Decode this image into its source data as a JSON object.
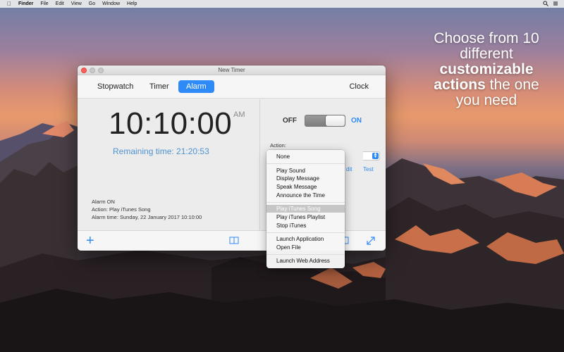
{
  "menubar": {
    "items": [
      {
        "label": "Finder",
        "bold": true
      },
      {
        "label": "File"
      },
      {
        "label": "Edit"
      },
      {
        "label": "View"
      },
      {
        "label": "Go"
      },
      {
        "label": "Window"
      },
      {
        "label": "Help"
      }
    ]
  },
  "promo": {
    "line1": "Choose from 10",
    "line2": "different",
    "line3": "customizable",
    "line4_bold": "actions",
    "line4_rest": " the one",
    "line5": "you need"
  },
  "window": {
    "title": "New Timer",
    "tabs": [
      {
        "label": "Stopwatch"
      },
      {
        "label": "Timer"
      },
      {
        "label": "Alarm",
        "active": true
      },
      {
        "label": "Clock"
      }
    ],
    "main": {
      "time": "10:10:00",
      "ampm": "AM",
      "remaining": "Remaining time: 21:20:53",
      "status": "Alarm ON",
      "action_line": "Action: Play iTunes Song",
      "alarm_time_line": "Alarm time: Sunday, 22 January 2017 10:10:00"
    },
    "side": {
      "off_label": "OFF",
      "on_label": "ON",
      "toggle_state": "on",
      "action_label": "Action:",
      "edit_partial": "dit",
      "test_label": "Test"
    }
  },
  "dropdown": {
    "items": [
      {
        "label": "None"
      },
      {
        "label": "Play Sound"
      },
      {
        "label": "Display Message"
      },
      {
        "label": "Speak Message"
      },
      {
        "label": "Announce the Time"
      },
      {
        "label": "Play iTunes Song",
        "highlighted": true
      },
      {
        "label": "Play iTunes Playlist"
      },
      {
        "label": "Stop iTunes"
      },
      {
        "label": "Launch Application"
      },
      {
        "label": "Open File"
      },
      {
        "label": "Launch Web Address"
      }
    ]
  },
  "colors": {
    "accent": "#2d8af7",
    "remaining_text": "#4f92d1",
    "close_button": "#fd5f57"
  },
  "icons": [
    "apple-icon",
    "plus-icon",
    "book-icon",
    "resize-icon",
    "expand-icon",
    "search-icon",
    "menu-icon"
  ]
}
